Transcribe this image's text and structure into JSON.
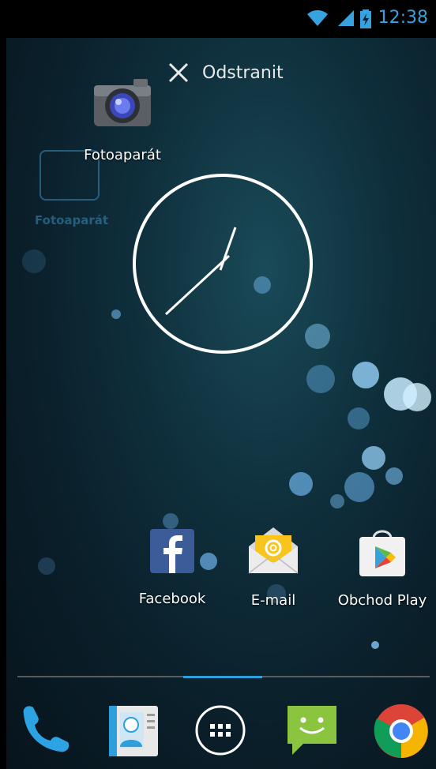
{
  "status_bar": {
    "time": "12:38",
    "icons": [
      "wifi-icon",
      "signal-icon",
      "battery-charging-icon"
    ],
    "accent_color": "#36a3e0"
  },
  "drag": {
    "remove_label": "Odstranit",
    "dragged_app_label": "Fotoaparát",
    "ghost_label": "Fotoaparát"
  },
  "apps": [
    {
      "label": "Facebook",
      "icon": "facebook-icon"
    },
    {
      "label": "E-mail",
      "icon": "email-icon"
    },
    {
      "label": "Obchod Play",
      "icon": "play-store-icon"
    }
  ],
  "dock": [
    {
      "icon": "phone-icon"
    },
    {
      "icon": "contacts-icon"
    },
    {
      "icon": "app-drawer-icon"
    },
    {
      "icon": "messaging-icon"
    },
    {
      "icon": "chrome-icon"
    }
  ]
}
